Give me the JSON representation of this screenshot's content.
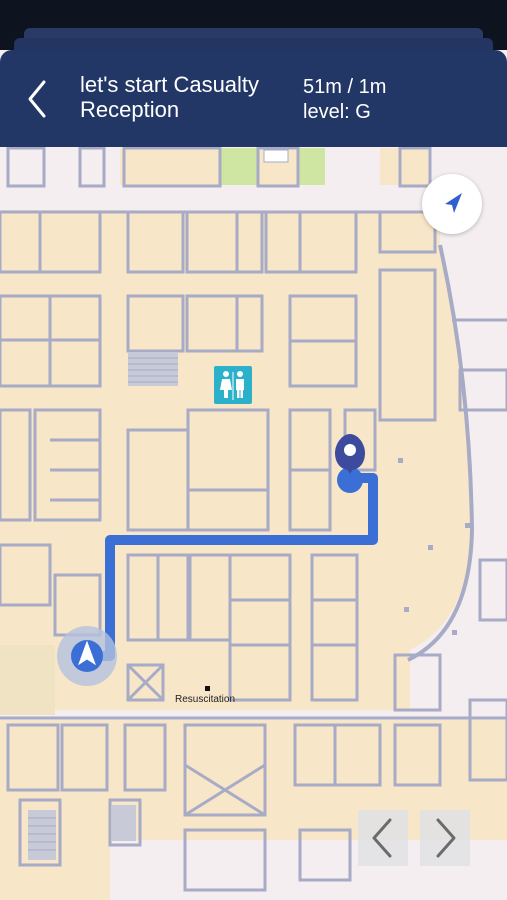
{
  "header": {
    "back_icon": "chevron-left-icon",
    "title": "let's start Casualty Reception",
    "distance": "51m / 1m",
    "level": "level: G"
  },
  "map": {
    "poi_label": "Resuscitation",
    "restroom_icon": "restroom-icon",
    "destination_icon": "map-pin-icon",
    "user_icon": "navigation-arrow-icon",
    "locate_icon": "location-arrow-icon",
    "colors": {
      "floor": "#f7e6c8",
      "walls": "#a7abc6",
      "route": "#3b6fd6",
      "header": "#233766",
      "restroom": "#2bb1c9",
      "green_area": "#cfe6a3"
    }
  },
  "controls": {
    "prev_icon": "chevron-left-icon",
    "next_icon": "chevron-right-icon"
  }
}
